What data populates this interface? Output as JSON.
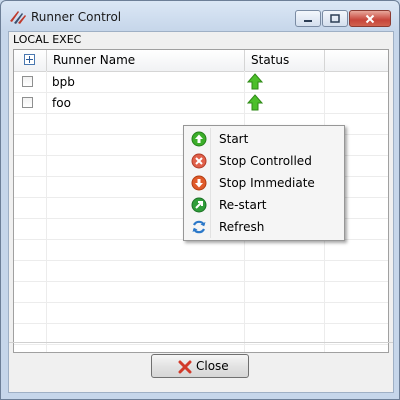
{
  "window": {
    "title": "Runner Control"
  },
  "group": {
    "label": "LOCAL EXEC"
  },
  "table": {
    "columns": [
      "Runner Name",
      "Status"
    ],
    "rows": [
      {
        "name": "bpb",
        "status": "up-arrow-green-icon",
        "checked": false
      },
      {
        "name": "foo",
        "status": "up-arrow-green-icon",
        "checked": false
      }
    ]
  },
  "context_menu": {
    "items": [
      {
        "label": "Start",
        "icon": "start-icon",
        "color": "#3cae2a"
      },
      {
        "label": "Stop Controlled",
        "icon": "stop-controlled-icon",
        "color": "#e0604a"
      },
      {
        "label": "Stop Immediate",
        "icon": "stop-immediate-icon",
        "color": "#e05a2a"
      },
      {
        "label": "Re-start",
        "icon": "restart-icon",
        "color": "#2f9e3a"
      },
      {
        "label": "Refresh",
        "icon": "refresh-icon",
        "color": "#2b78c9"
      }
    ]
  },
  "footer": {
    "close_label": "Close"
  }
}
